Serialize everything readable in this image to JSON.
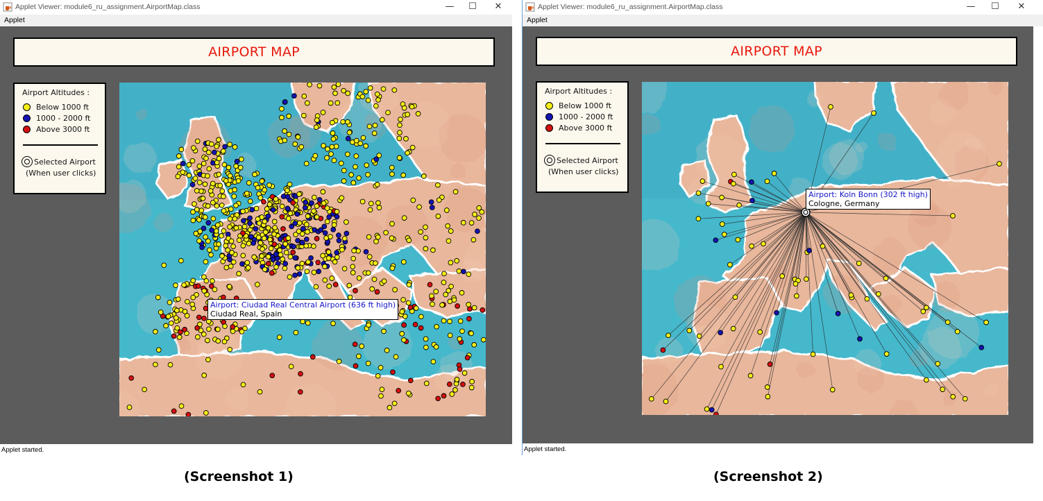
{
  "windows": [
    {
      "title": "Applet Viewer: module6_ru_assignment.AirportMap.class",
      "menu": "Applet",
      "header": "AIRPORT MAP",
      "legend": {
        "title": "Airport Altitudes :",
        "items": [
          {
            "label": "Below 1000 ft",
            "color": "#f5ee17"
          },
          {
            "label": "1000 - 2000 ft",
            "color": "#1414b4"
          },
          {
            "label": "Above 3000 ft",
            "color": "#d41010"
          }
        ],
        "selected_label": "Selected Airport",
        "selected_note": "(When user clicks)"
      },
      "tooltip": {
        "name": "Airport: Ciudad Real Central Airport (636 ft high)",
        "location": "Ciudad Real, Spain"
      },
      "status": "Applet started.",
      "caption": "(Screenshot 1)"
    },
    {
      "title": "Applet Viewer: module6_ru_assignment.AirportMap.class",
      "menu": "Applet",
      "header": "AIRPORT MAP",
      "legend": {
        "title": "Airport Altitudes :",
        "items": [
          {
            "label": "Below 1000 ft",
            "color": "#f5ee17"
          },
          {
            "label": "1000 - 2000 ft",
            "color": "#1414b4"
          },
          {
            "label": "Above 3000 ft",
            "color": "#d41010"
          }
        ],
        "selected_label": "Selected Airport",
        "selected_note": "(When user clicks)"
      },
      "tooltip": {
        "name": "Airport: Koln Bonn (302 ft high)",
        "location": "Cologne, Germany"
      },
      "status": "Applet started.",
      "caption": "(Screenshot 2)"
    }
  ],
  "window_controls": {
    "minimize": "—",
    "maximize": "☐",
    "close": "✕"
  },
  "colors": {
    "sea": "#45b8cc",
    "land": "#e9b79c",
    "applet_bg": "#5c5c5c",
    "title_red": "#e8180c",
    "tooltip_blue": "#1515c8"
  }
}
